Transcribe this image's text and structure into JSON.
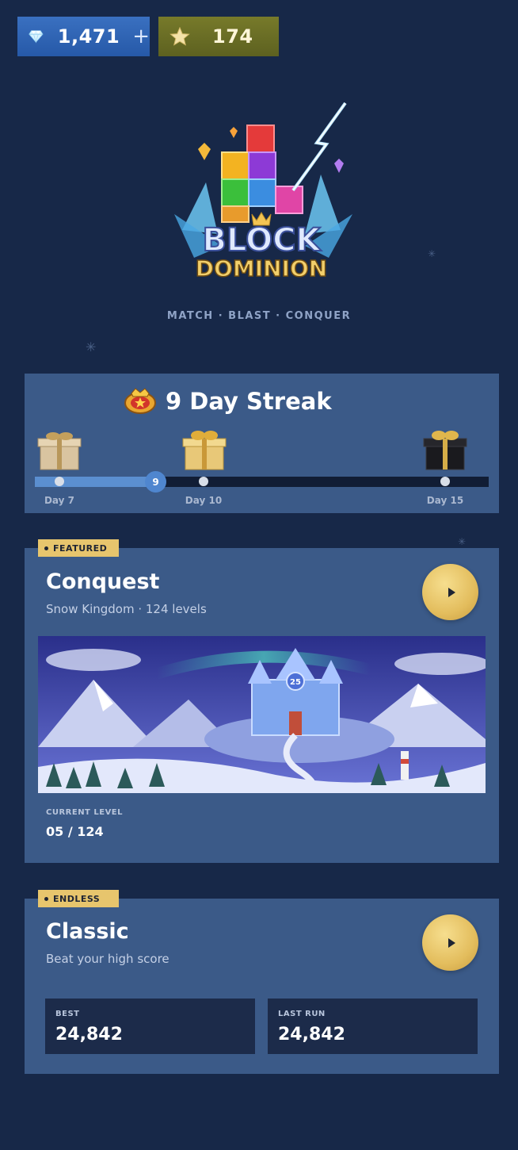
{
  "currency": {
    "gems": "1,471",
    "gems_icon": "diamond-icon",
    "add_label": "+",
    "stars": "174",
    "stars_icon": "star-icon"
  },
  "logo": {
    "line1": "BLOCK",
    "line2": "DOMINION"
  },
  "tagline": "MATCH · BLAST · CONQUER",
  "streak": {
    "title": "9 Day Streak",
    "current_day": "9",
    "milestones": [
      {
        "label": "Day 7",
        "reward": "gift-icon"
      },
      {
        "label": "Day 10",
        "reward": "gift-icon"
      },
      {
        "label": "Day 15",
        "reward": "gift-icon"
      }
    ]
  },
  "featured": {
    "tag": "FEATURED",
    "title": "Conquest",
    "subtitle": "Snow Kingdom · 124 levels",
    "castle_number": "25",
    "level_label": "CURRENT LEVEL",
    "level_value": "05 / 124"
  },
  "endless": {
    "tag": "ENDLESS",
    "title": "Classic",
    "subtitle": "Beat your high score",
    "best_label": "BEST",
    "best_value": "24,842",
    "last_label": "LAST RUN",
    "last_value": "24,842"
  },
  "colors": {
    "background": "#172848",
    "card": "#3b5a88",
    "accent_gold": "#e7c56d",
    "progress": "#5b8fd0"
  }
}
